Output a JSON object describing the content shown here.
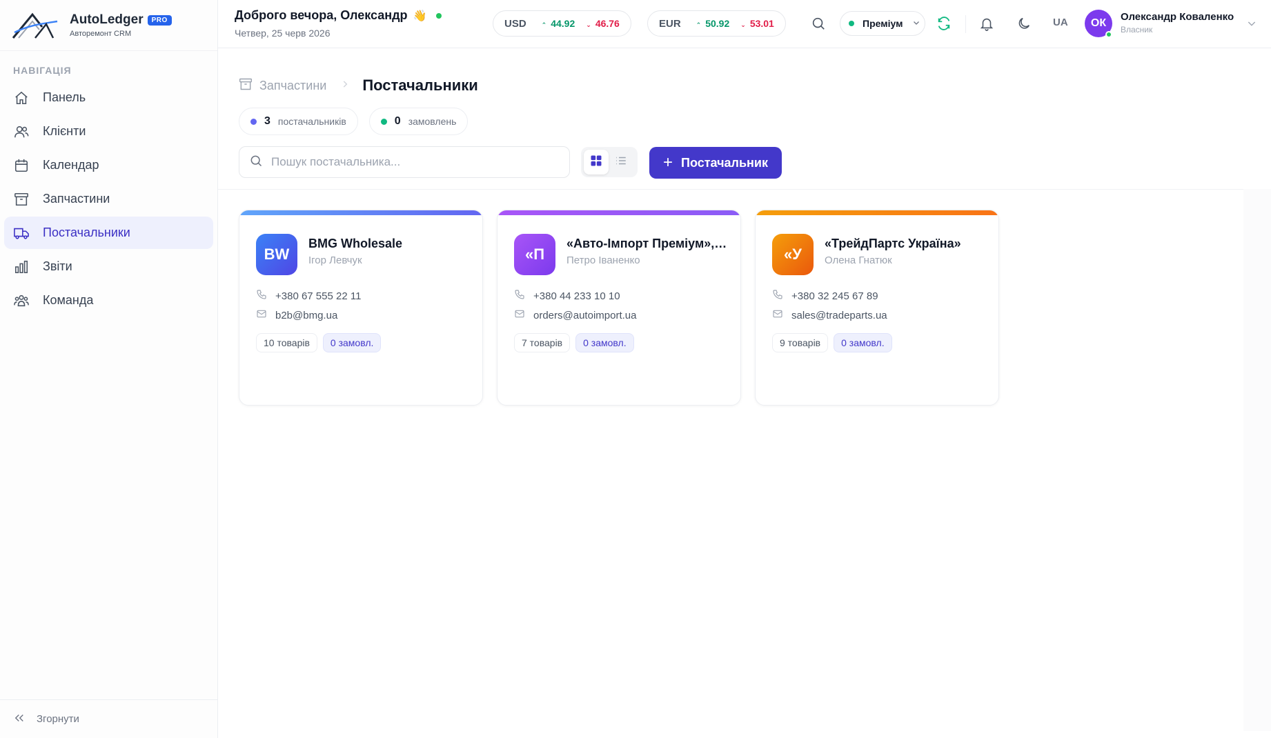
{
  "brand": {
    "name": "AutoLedger",
    "badge": "PRO",
    "subtitle": "Авторемонт CRM"
  },
  "sidebar": {
    "title": "НАВІГАЦІЯ",
    "items": [
      {
        "label": "Панель",
        "icon": "home-icon"
      },
      {
        "label": "Клієнти",
        "icon": "users-icon"
      },
      {
        "label": "Календар",
        "icon": "calendar-icon"
      },
      {
        "label": "Запчастини",
        "icon": "archive-icon"
      },
      {
        "label": "Постачальники",
        "icon": "truck-icon",
        "active": true
      },
      {
        "label": "Звіти",
        "icon": "bar-chart-icon"
      },
      {
        "label": "Команда",
        "icon": "team-icon"
      }
    ],
    "collapse_label": "Згорнути"
  },
  "header": {
    "greeting": "Доброго вечора, Олександр",
    "greeting_emoji": "👋",
    "date": "Четвер, 25 черв 2026",
    "rates": [
      {
        "currency": "USD",
        "buy": "44.92",
        "sell": "46.76"
      },
      {
        "currency": "EUR",
        "buy": "50.92",
        "sell": "53.01"
      }
    ],
    "plan": "Преміум",
    "language": "UA",
    "user": {
      "initials": "ОК",
      "name": "Олександр Коваленко",
      "role": "Власник"
    },
    "colors": {
      "up": "#059669",
      "down": "#e11d48",
      "online": "#22c55e",
      "avatar": "#7c3aed"
    }
  },
  "main": {
    "breadcrumb": {
      "parent": "Запчастини",
      "current": "Постачальники"
    },
    "stats": [
      {
        "value": "3",
        "label": "постачальників",
        "color": "#6366f1"
      },
      {
        "value": "0",
        "label": "замовлень",
        "color": "#10b981"
      }
    ],
    "search": {
      "placeholder": "Пошук постачальника...",
      "value": ""
    },
    "add_button": "Постачальник",
    "accent": "#4338ca",
    "suppliers": [
      {
        "initials": "BW",
        "name": "BMG Wholesale",
        "contact": "Ігор Левчук",
        "phone": "+380 67 555 22 11",
        "email": "b2b@bmg.ua",
        "items": "10 товарів",
        "orders": "0 замовл.",
        "bar": "linear-gradient(90deg,#60a5fa,#6366f1)",
        "logo": "linear-gradient(135deg,#3b82f6,#4f46e5)"
      },
      {
        "initials": "«П",
        "name": "«Авто-Імпорт Преміум», ТОВ",
        "contact": "Петро Іваненко",
        "phone": "+380 44 233 10 10",
        "email": "orders@autoimport.ua",
        "items": "7 товарів",
        "orders": "0 замовл.",
        "bar": "linear-gradient(90deg,#a855f7,#8b5cf6)",
        "logo": "linear-gradient(135deg,#a855f7,#7c3aed)"
      },
      {
        "initials": "«У",
        "name": "«ТрейдПартс Україна»",
        "contact": "Олена Гнатюк",
        "phone": "+380 32 245 67 89",
        "email": "sales@tradeparts.ua",
        "items": "9 товарів",
        "orders": "0 замовл.",
        "bar": "linear-gradient(90deg,#f59e0b,#f97316)",
        "logo": "linear-gradient(135deg,#f59e0b,#ea580c)"
      }
    ]
  }
}
